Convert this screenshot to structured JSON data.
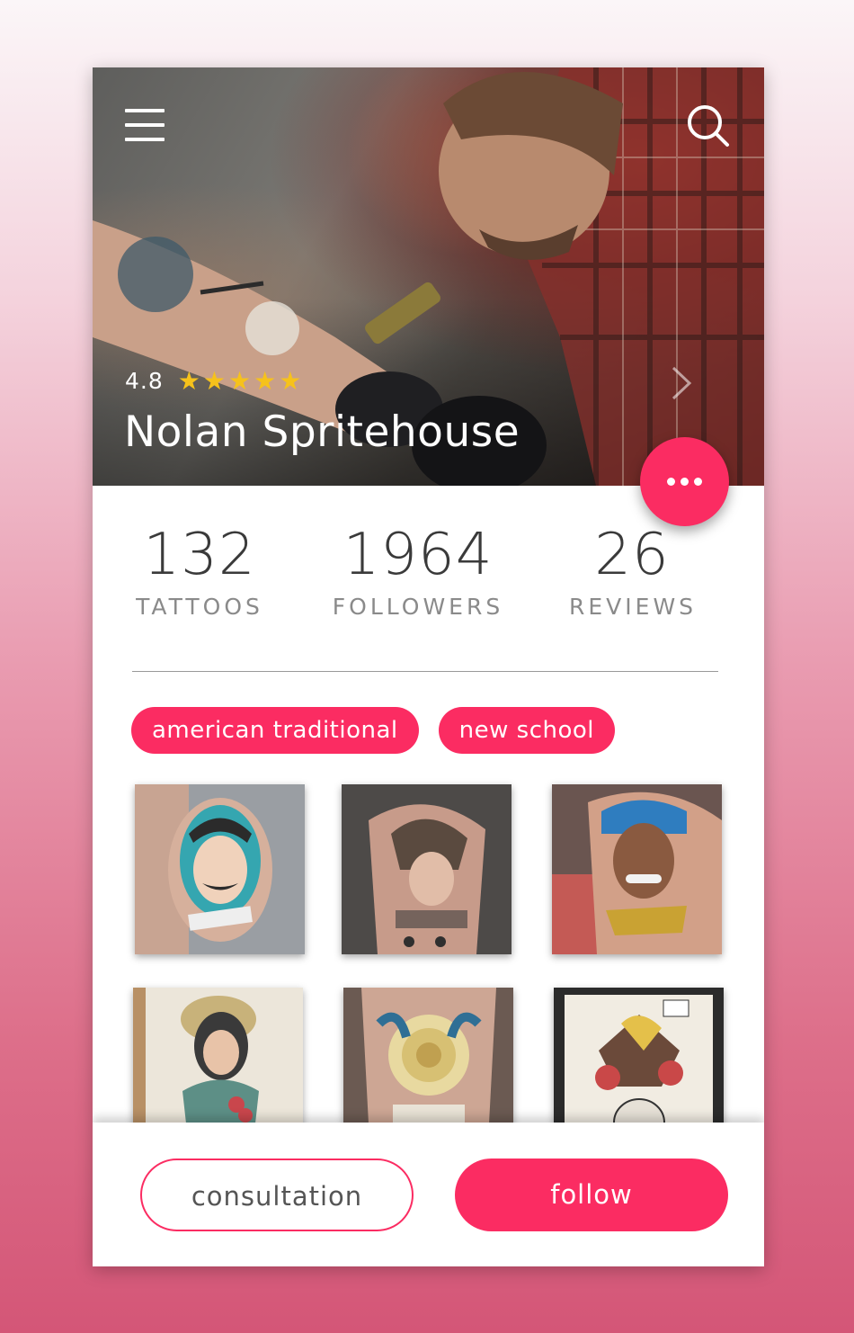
{
  "header": {
    "menu_icon": "hamburger-menu-icon",
    "search_icon": "search-icon",
    "next_icon": "chevron-right-icon"
  },
  "artist": {
    "rating": "4.8",
    "stars": 5,
    "name": "Nolan Spritehouse"
  },
  "more_button": {
    "icon": "more-dots-icon"
  },
  "stats": [
    {
      "value": "132",
      "label": "TATTOOS"
    },
    {
      "value": "1964",
      "label": "FOLLOWERS"
    },
    {
      "value": "26",
      "label": "REVIEWS"
    }
  ],
  "tags": [
    "american traditional",
    "new school"
  ],
  "gallery": [
    {
      "icon": "gentleman-tattoo-thumbnail"
    },
    {
      "icon": "native-headdress-tattoo-thumbnail"
    },
    {
      "icon": "portrait-tattoo-thumbnail"
    },
    {
      "icon": "lady-flash-tattoo-thumbnail"
    },
    {
      "icon": "rose-tattoo-thumbnail"
    },
    {
      "icon": "eagle-skull-flash-thumbnail"
    }
  ],
  "actions": {
    "consultation_label": "consultation",
    "follow_label": "follow"
  },
  "colors": {
    "accent": "#fb2c62",
    "star": "#f6c21b",
    "text_dark": "#3a3a3a",
    "text_muted": "#8a8a8a"
  }
}
